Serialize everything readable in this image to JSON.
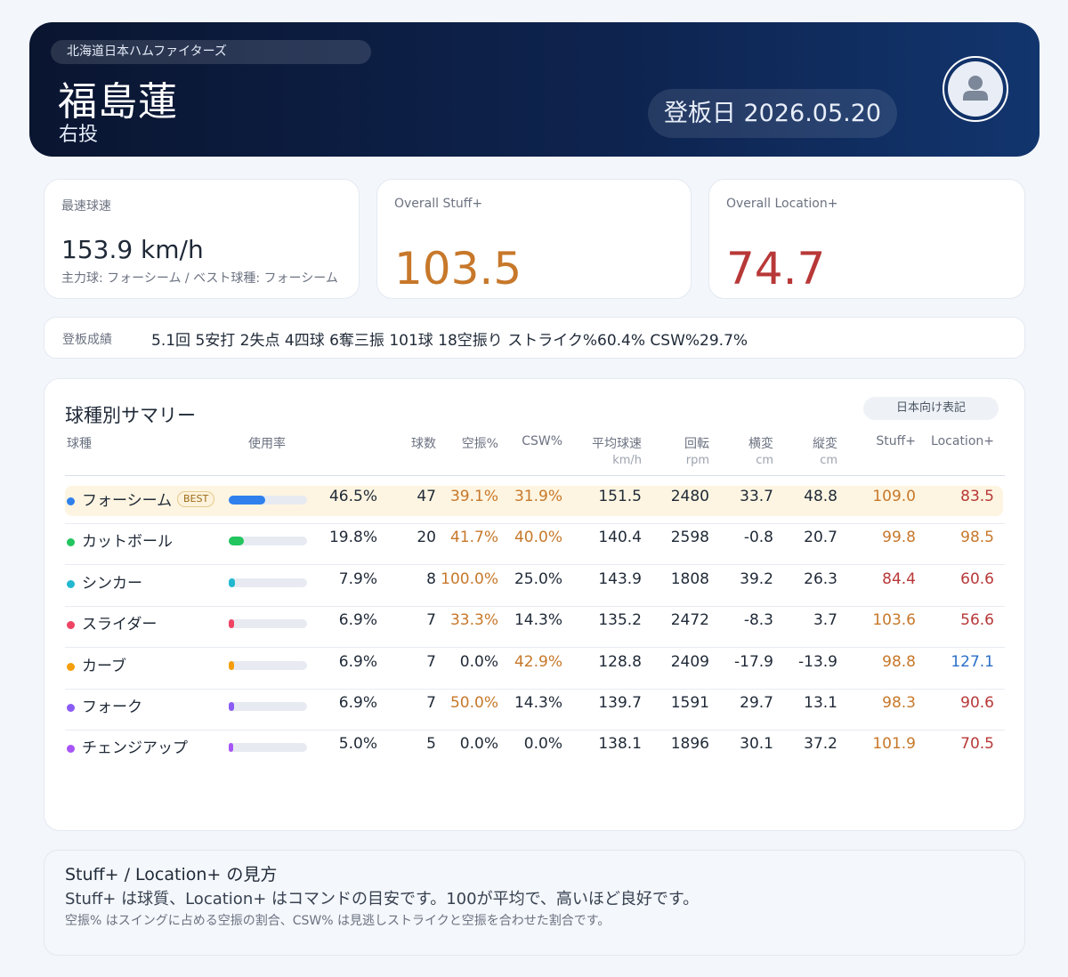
{
  "header": {
    "team": "北海道日本ハムファイターズ",
    "name": "福島蓮",
    "hand": "右投",
    "date": "登板日 2026.05.20"
  },
  "stats": {
    "top_speed_label": "最速球速",
    "top_speed_value": "153.9 km/h",
    "top_speed_sub": "主力球: フォーシーム / ベスト球種: フォーシーム",
    "stuff_label": "Overall Stuff+",
    "stuff_value": "103.5",
    "location_label": "Overall Location+",
    "location_value": "74.7"
  },
  "result": {
    "label": "登板成績",
    "text": "5.1回 5安打 2失点 4四球 6奪三振 101球 18空振り ストライク%60.4% CSW%29.7%"
  },
  "summary": {
    "title": "球種別サマリー",
    "notation": "日本向け表記",
    "columns": {
      "pitch": "球種",
      "usage": "使用率",
      "count": "球数",
      "whiff": "空振%",
      "csw": "CSW%",
      "velo": "平均球速",
      "velo_unit": "km/h",
      "spin": "回転",
      "spin_unit": "rpm",
      "hbreak": "横変",
      "hbreak_unit": "cm",
      "vbreak": "縦変",
      "vbreak_unit": "cm",
      "stuff": "Stuff+",
      "location": "Location+"
    },
    "best_label": "BEST",
    "rows": [
      {
        "name": "フォーシーム",
        "dot_color": "#2f80ed",
        "usage": "46.5%",
        "usage_frac": 0.465,
        "count": "47",
        "whiff": "39.1%",
        "whiff_color": "#c7782a",
        "csw": "31.9%",
        "csw_color": "#c7782a",
        "velo": "151.5",
        "spin": "2480",
        "hbreak": "33.7",
        "vbreak": "48.8",
        "stuff": "109.0",
        "stuff_color": "#c7782a",
        "location": "83.5",
        "location_color": "#b83838",
        "best": true
      },
      {
        "name": "カットボール",
        "dot_color": "#22c55e",
        "usage": "19.8%",
        "usage_frac": 0.198,
        "count": "20",
        "whiff": "41.7%",
        "whiff_color": "#c7782a",
        "csw": "40.0%",
        "csw_color": "#c7782a",
        "velo": "140.4",
        "spin": "2598",
        "hbreak": "-0.8",
        "vbreak": "20.7",
        "stuff": "99.8",
        "stuff_color": "#c7782a",
        "location": "98.5",
        "location_color": "#c7782a",
        "best": false
      },
      {
        "name": "シンカー",
        "dot_color": "#22b8cf",
        "usage": "7.9%",
        "usage_frac": 0.079,
        "count": "8",
        "whiff": "100.0%",
        "whiff_color": "#c7782a",
        "csw": "25.0%",
        "csw_color": "#1f2937",
        "velo": "143.9",
        "spin": "1808",
        "hbreak": "39.2",
        "vbreak": "26.3",
        "stuff": "84.4",
        "stuff_color": "#b83838",
        "location": "60.6",
        "location_color": "#b83838",
        "best": false
      },
      {
        "name": "スライダー",
        "dot_color": "#ef4464",
        "usage": "6.9%",
        "usage_frac": 0.069,
        "count": "7",
        "whiff": "33.3%",
        "whiff_color": "#c7782a",
        "csw": "14.3%",
        "csw_color": "#1f2937",
        "velo": "135.2",
        "spin": "2472",
        "hbreak": "-8.3",
        "vbreak": "3.7",
        "stuff": "103.6",
        "stuff_color": "#c7782a",
        "location": "56.6",
        "location_color": "#b83838",
        "best": false
      },
      {
        "name": "カーブ",
        "dot_color": "#f59e0b",
        "usage": "6.9%",
        "usage_frac": 0.069,
        "count": "7",
        "whiff": "0.0%",
        "whiff_color": "#1f2937",
        "csw": "42.9%",
        "csw_color": "#c7782a",
        "velo": "128.8",
        "spin": "2409",
        "hbreak": "-17.9",
        "vbreak": "-13.9",
        "stuff": "98.8",
        "stuff_color": "#c7782a",
        "location": "127.1",
        "location_color": "#2a6fc9",
        "best": false
      },
      {
        "name": "フォーク",
        "dot_color": "#8b5cf6",
        "usage": "6.9%",
        "usage_frac": 0.069,
        "count": "7",
        "whiff": "50.0%",
        "whiff_color": "#c7782a",
        "csw": "14.3%",
        "csw_color": "#1f2937",
        "velo": "139.7",
        "spin": "1591",
        "hbreak": "29.7",
        "vbreak": "13.1",
        "stuff": "98.3",
        "stuff_color": "#c7782a",
        "location": "90.6",
        "location_color": "#b83838",
        "best": false
      },
      {
        "name": "チェンジアップ",
        "dot_color": "#a855f7",
        "usage": "5.0%",
        "usage_frac": 0.05,
        "count": "5",
        "whiff": "0.0%",
        "whiff_color": "#1f2937",
        "csw": "0.0%",
        "csw_color": "#1f2937",
        "velo": "138.1",
        "spin": "1896",
        "hbreak": "30.1",
        "vbreak": "37.2",
        "stuff": "101.9",
        "stuff_color": "#c7782a",
        "location": "70.5",
        "location_color": "#b83838",
        "best": false
      }
    ]
  },
  "explanation": {
    "title": "Stuff+ / Location+ の見方",
    "main": "Stuff+ は球質、Location+ はコマンドの目安です。100が平均で、高いほど良好です。",
    "note": "空振% はスイングに占める空振の割合、CSW% は見逃しストライクと空振を合わせた割合です。"
  },
  "colors": {
    "stuff_overall": "#c7782a",
    "location_overall": "#b83838"
  },
  "icons": {
    "avatar": "user-avatar-icon"
  }
}
